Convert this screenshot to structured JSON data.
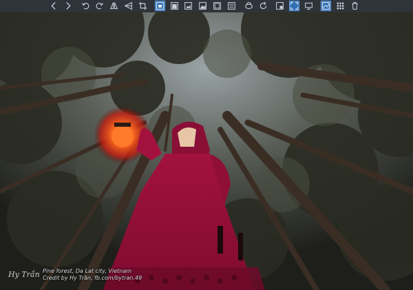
{
  "photo": {
    "caption_line1": "Pine forest, Da Lat city, Vietnam",
    "caption_line2": "Credit by Hy Trần, fb.com/bytran.49"
  },
  "toolbar": {
    "buttons": [
      {
        "name": "previous-icon",
        "active": false
      },
      {
        "name": "next-icon",
        "active": false
      },
      {
        "name": "rotate-left-icon",
        "active": false
      },
      {
        "name": "rotate-right-icon",
        "active": false
      },
      {
        "name": "flip-horizontal-icon",
        "active": false
      },
      {
        "name": "flip-vertical-icon",
        "active": false
      },
      {
        "name": "crop-icon",
        "active": false
      },
      {
        "name": "fit-window-icon",
        "active": true
      },
      {
        "name": "fit-width-icon",
        "active": false
      },
      {
        "name": "fit-height-icon",
        "active": false
      },
      {
        "name": "fill-window-icon",
        "active": false
      },
      {
        "name": "actual-size-icon",
        "active": false
      },
      {
        "name": "auto-zoom-icon",
        "active": false
      },
      {
        "name": "lock-zoom-icon",
        "active": false
      },
      {
        "name": "bucket-icon",
        "active": false
      },
      {
        "name": "refresh-icon",
        "active": false
      },
      {
        "name": "slideshow-icon",
        "active": false
      },
      {
        "name": "fullscreen-icon",
        "active": true
      },
      {
        "name": "toggle-toolbar-icon",
        "active": false
      },
      {
        "name": "image-info-icon",
        "active": true
      },
      {
        "name": "thumbnails-icon",
        "active": false
      },
      {
        "name": "delete-icon",
        "active": false
      }
    ]
  },
  "colors": {
    "toolbar_bg": "#2f333a",
    "icon": "#c9ced6",
    "active_bg": "#2f6fb3",
    "dress": "#b5144a",
    "lantern": "#ff5a1f"
  }
}
